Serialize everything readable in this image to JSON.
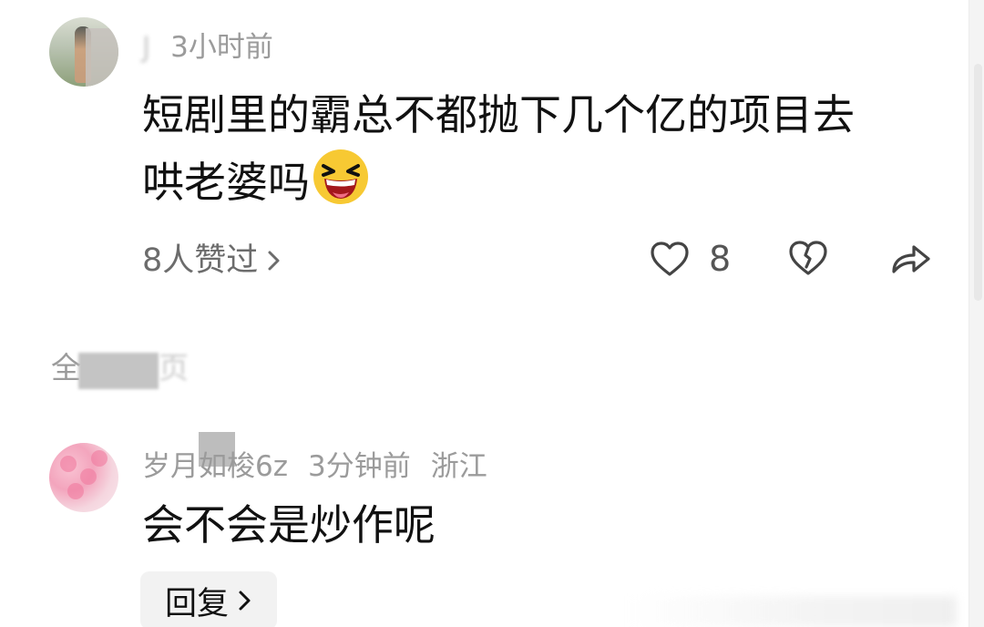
{
  "comments": [
    {
      "username": "J",
      "time": "3小时前",
      "text_line1": "短剧里的霸总不都抛下几个亿的项目去",
      "text_line2": "哄老婆吗",
      "likes_link": "8人赞过",
      "like_count": "8",
      "emoji": "grinning-squinting-face"
    },
    {
      "username": "岁月如梭6z",
      "time": "3分钟前",
      "location": "浙江",
      "text": "会不会是炒作呢",
      "reply_label": "回复"
    }
  ],
  "section": {
    "header_prefix": "全",
    "header_suffix": "页"
  },
  "icons": {
    "like": "heart-outline-icon",
    "dislike": "broken-heart-icon",
    "share": "share-arrow-icon",
    "chevron": "chevron-right-icon"
  },
  "colors": {
    "primary_text": "#111111",
    "secondary_text": "#9b9b9b",
    "link_text": "#6c6c6c",
    "button_bg": "#f2f2f2"
  }
}
